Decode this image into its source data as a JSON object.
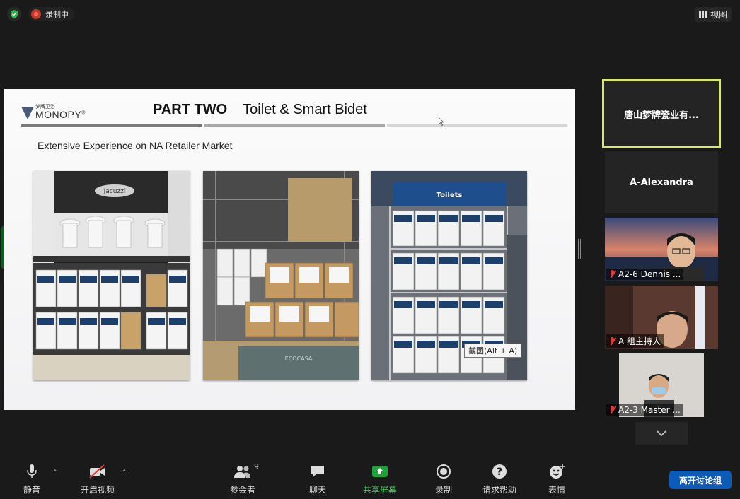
{
  "top_bar": {
    "recording_label": "录制中",
    "view_label": "视图"
  },
  "slide": {
    "logo_cn": "梦牌卫浴",
    "logo_en": "MONOPY",
    "logo_mark": "®",
    "title_part": "PART TWO",
    "title_sub": "Toilet & Smart Bidet",
    "subtitle": "Extensive Experience on NA Retailer Market",
    "photo_labels": {
      "p1_sign": "Jacuzzi",
      "p3_sign": "Toilets",
      "p2_box": "ECOCASA"
    }
  },
  "tooltip": "截图(Alt + A)",
  "participants": {
    "active_name": "唐山梦牌瓷业有...",
    "tiles": [
      {
        "name": "A-Alexandra"
      },
      {
        "name": "A2-6 Dennis ..."
      },
      {
        "name": "A 组主持人"
      },
      {
        "name": "A2-3 Master ..."
      }
    ]
  },
  "toolbar": {
    "mute_label": "静音",
    "video_label": "开启视频",
    "participants_label": "参会者",
    "participants_count": "9",
    "chat_label": "聊天",
    "share_label": "共享屏幕",
    "record_label": "录制",
    "help_label": "请求帮助",
    "reaction_label": "表情",
    "leave_label": "离开讨论组"
  },
  "colors": {
    "active_border": "#d9e76a",
    "share_green": "#43d160",
    "leave_blue": "#0e5ab8",
    "muted_red": "#e53935"
  }
}
